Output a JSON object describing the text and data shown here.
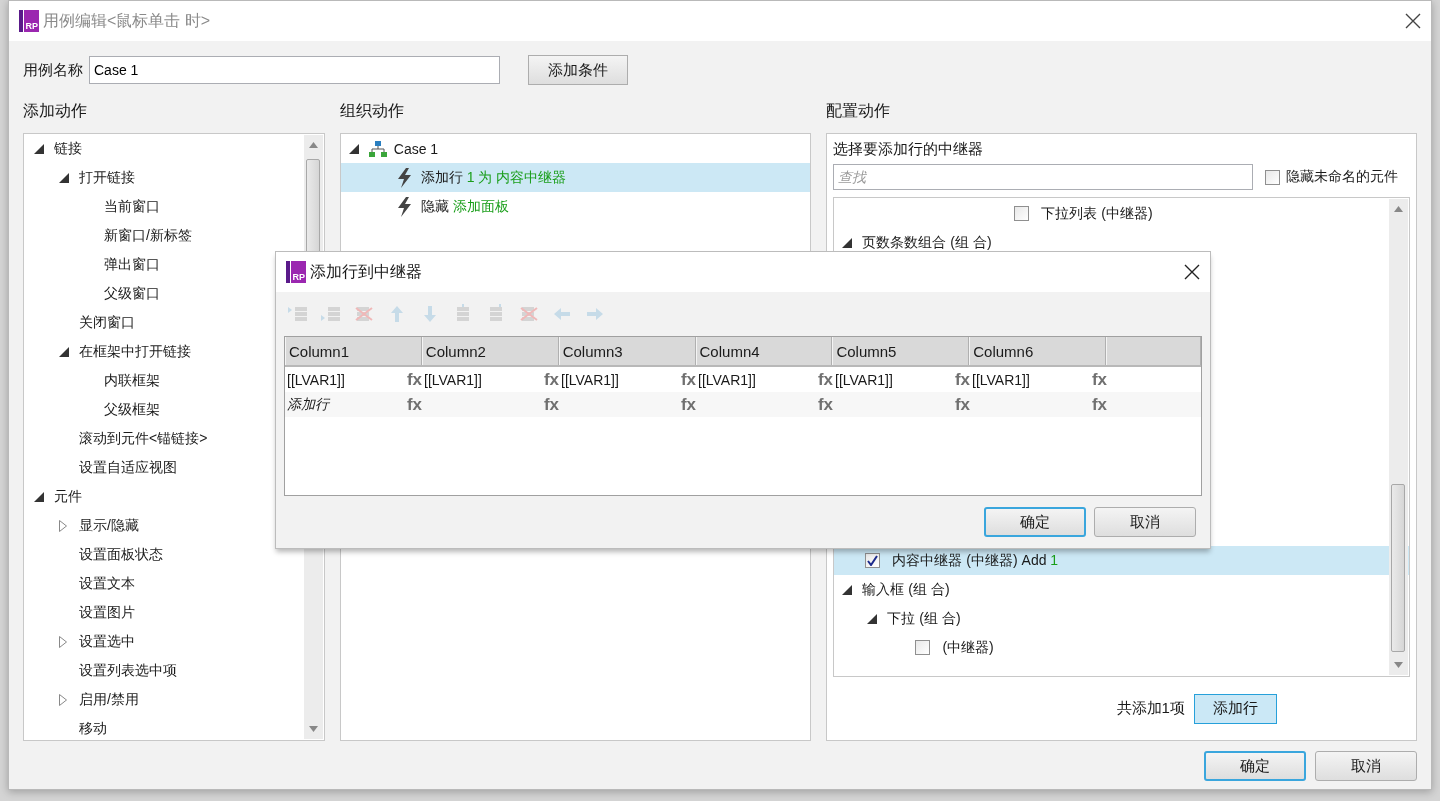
{
  "window": {
    "logo": "RP",
    "title": "用例编辑<鼠标单击 时>"
  },
  "case_name": {
    "label": "用例名称",
    "value": "Case 1"
  },
  "add_condition_button": "添加条件",
  "add_actions": {
    "heading": "添加动作",
    "tree": [
      {
        "label": "链接",
        "expanded": true,
        "children": [
          {
            "label": "打开链接",
            "expanded": true,
            "children": [
              {
                "label": "当前窗口"
              },
              {
                "label": "新窗口/新标签"
              },
              {
                "label": "弹出窗口"
              },
              {
                "label": "父级窗口"
              }
            ]
          },
          {
            "label": "关闭窗口"
          },
          {
            "label": "在框架中打开链接",
            "expanded": true,
            "children": [
              {
                "label": "内联框架"
              },
              {
                "label": "父级框架"
              }
            ]
          },
          {
            "label": "滚动到元件<锚链接>"
          },
          {
            "label": "设置自适应视图"
          }
        ]
      },
      {
        "label": "元件",
        "expanded": true,
        "children": [
          {
            "label": "显示/隐藏",
            "expanded": false
          },
          {
            "label": "设置面板状态"
          },
          {
            "label": "设置文本"
          },
          {
            "label": "设置图片"
          },
          {
            "label": "设置选中",
            "expanded": false
          },
          {
            "label": "设置列表选中项"
          },
          {
            "label": "启用/禁用",
            "expanded": false
          },
          {
            "label": "移动"
          }
        ]
      }
    ]
  },
  "organize_actions": {
    "heading": "组织动作",
    "cases": [
      {
        "label": "Case 1",
        "expanded": true,
        "actions": [
          {
            "verb": "添加行",
            "detail": "1 为 内容中继器",
            "selected": true
          },
          {
            "verb": "隐藏",
            "detail": "添加面板",
            "selected": false
          }
        ]
      }
    ]
  },
  "configure_action": {
    "heading": "配置动作",
    "title": "选择要添加行的中继器",
    "search": {
      "placeholder": "查找"
    },
    "hide_unnamed": {
      "label": "隐藏未命名的元件",
      "checked": false
    },
    "tree_top": {
      "label": "下拉列表 (中继器)",
      "checked": false,
      "selected": false
    },
    "tree": [
      {
        "label": "页数条数组合 (组 合)",
        "expanded": true,
        "children": [
          {
            "label": "内容中继器 (中继器)",
            "suffix": "Add",
            "count": "1",
            "checked": true,
            "selected": true
          }
        ]
      },
      {
        "label": "输入框 (组 合)",
        "expanded": true,
        "children": [
          {
            "label": "下拉 (组 合)",
            "expanded": true,
            "children": [
              {
                "label": "(中继器)",
                "checked": false,
                "selected": false
              }
            ]
          }
        ]
      }
    ],
    "summary": "共添加1项",
    "add_row_button": "添加行"
  },
  "buttons": [
    {
      "label": "确定",
      "focused": true
    },
    {
      "label": "取消",
      "focused": false
    }
  ],
  "add_row_dialog": {
    "logo": "RP",
    "title": "添加行到中继器",
    "toolbar": {
      "disabled": true
    },
    "columns": [
      "Column1",
      "Column2",
      "Column3",
      "Column4",
      "Column5",
      "Column6"
    ],
    "rows": [
      {
        "cells": [
          {
            "value": "[[LVAR1]]",
            "fx": "fx"
          },
          {
            "value": "[[LVAR1]]",
            "fx": "fx"
          },
          {
            "value": "[[LVAR1]]",
            "fx": "fx"
          },
          {
            "value": "[[LVAR1]]",
            "fx": "fx"
          },
          {
            "value": "[[LVAR1]]",
            "fx": "fx"
          },
          {
            "value": "[[LVAR1]]",
            "fx": "fx"
          }
        ]
      }
    ],
    "new_row": {
      "label": "添加行",
      "fx": [
        "fx",
        "fx",
        "fx",
        "fx",
        "fx",
        "fx"
      ]
    },
    "buttons": [
      {
        "label": "确定",
        "focused": true
      },
      {
        "label": "取消",
        "focused": false
      }
    ]
  }
}
